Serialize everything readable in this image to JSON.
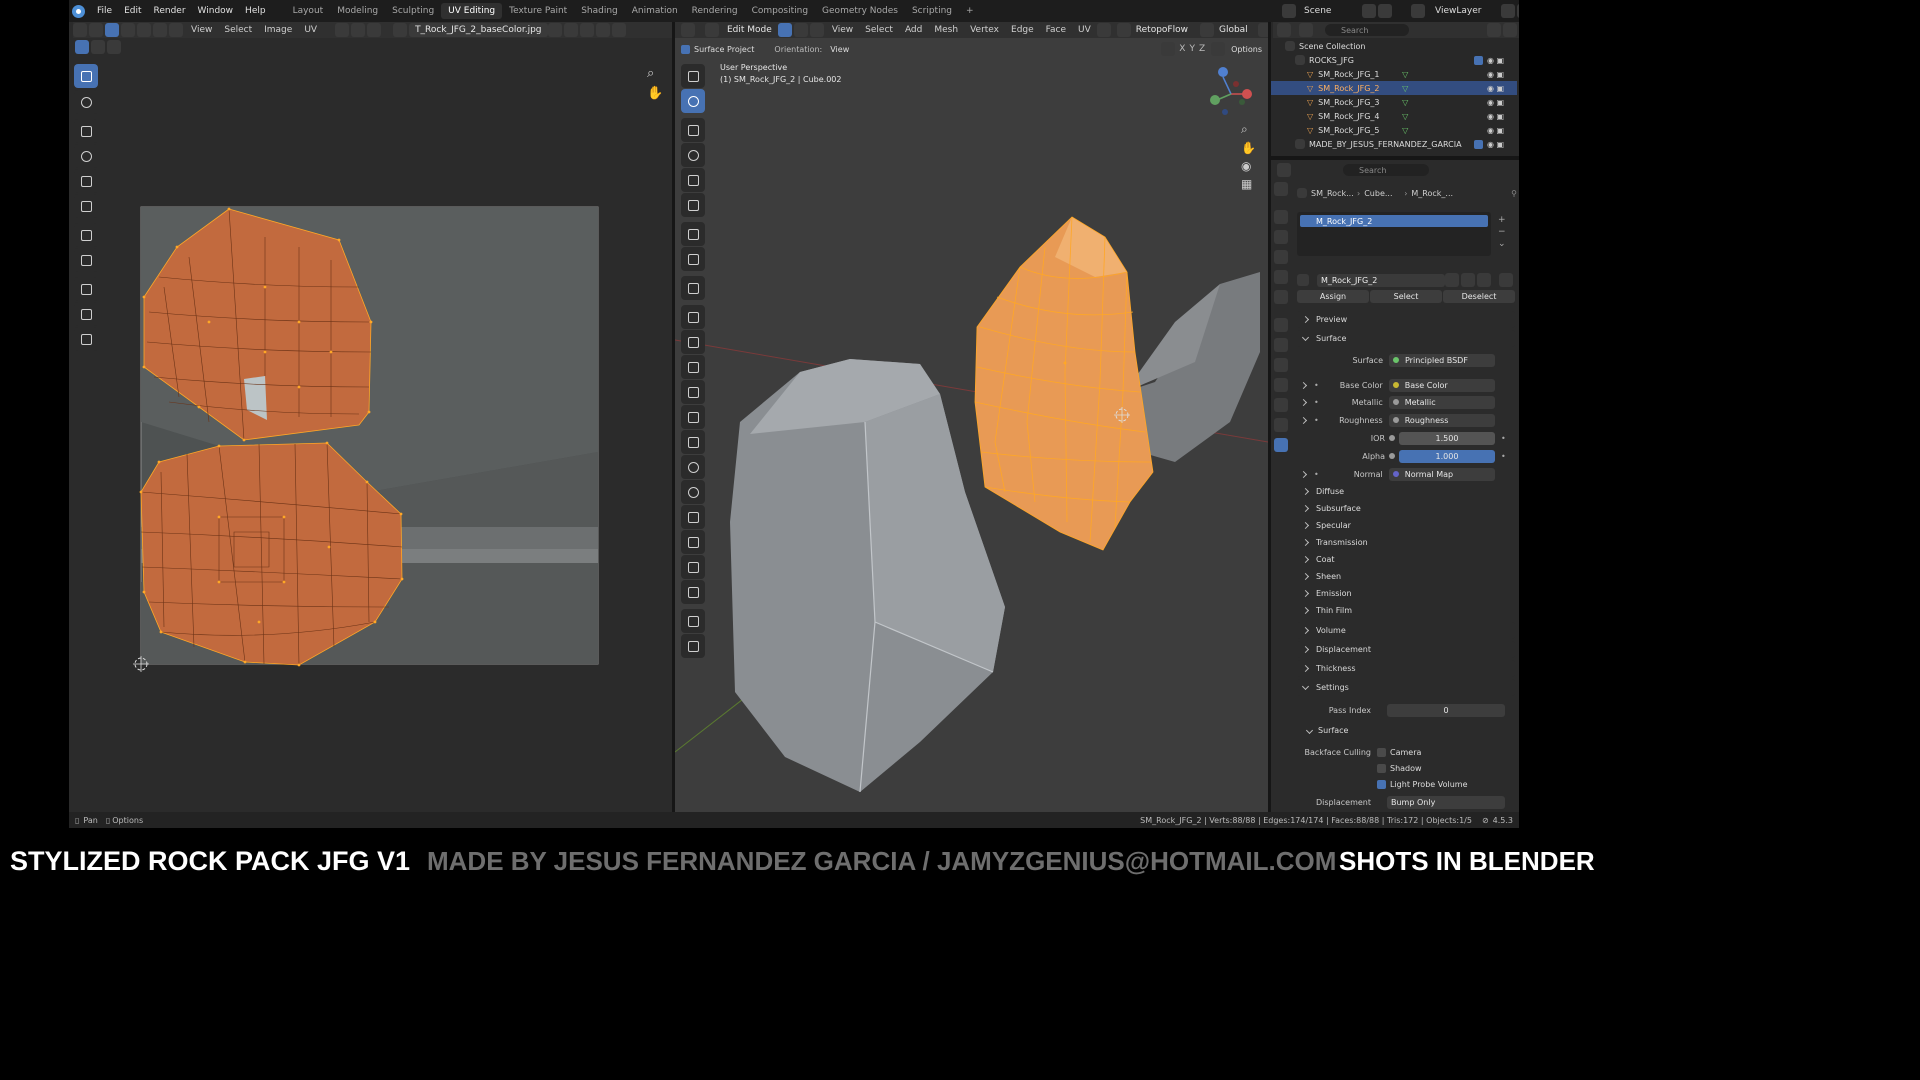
{
  "menu": {
    "file": "File",
    "edit": "Edit",
    "render": "Render",
    "window": "Window",
    "help": "Help"
  },
  "workspaces": [
    "Layout",
    "Modeling",
    "Sculpting",
    "UV Editing",
    "Texture Paint",
    "Shading",
    "Animation",
    "Rendering",
    "Compositing",
    "Geometry Nodes",
    "Scripting"
  ],
  "add_workspace": "+",
  "scene": {
    "label": "Scene",
    "viewlayer": "ViewLayer"
  },
  "uv_editor": {
    "menus": [
      "View",
      "Select",
      "Image",
      "UV"
    ],
    "image_name": "T_Rock_JFG_2_baseColor.jpg"
  },
  "viewport": {
    "mode": "Edit Mode",
    "menus": [
      "View",
      "Select",
      "Add",
      "Mesh",
      "Vertex",
      "Edge",
      "Face",
      "UV"
    ],
    "addon": "RetopoFlow",
    "orientation": "Global",
    "surface_project": "Surface Project",
    "orientation_label": "Orientation:",
    "orientation_value": "View",
    "options": "Options",
    "perspective": "User Perspective",
    "object_info": "(1) SM_Rock_JFG_2 | Cube.002",
    "gizmo": {
      "x": "X",
      "y": "Y",
      "z": "Z"
    }
  },
  "outliner": {
    "search_placeholder": "Search",
    "title": "Scene Collection",
    "collection": "ROCKS_JFG",
    "items": [
      "SM_Rock_JFG_1",
      "SM_Rock_JFG_2",
      "SM_Rock_JFG_3",
      "SM_Rock_JFG_4",
      "SM_Rock_JFG_5"
    ],
    "selected_index": 1,
    "made_by": "MADE_BY_JESUS_FERNANDEZ_GARCIA"
  },
  "properties": {
    "search_placeholder": "Search",
    "breadcrumb": [
      "SM_Rock...",
      "Cube...",
      "M_Rock_..."
    ],
    "slot": "M_Rock_JFG_2",
    "material": "M_Rock_JFG_2",
    "buttons": {
      "assign": "Assign",
      "select": "Select",
      "deselect": "Deselect"
    },
    "preview": "Preview",
    "surface_header": "Surface",
    "surface_row": {
      "label": "Surface",
      "value": "Principled BSDF"
    },
    "inputs": [
      {
        "label": "Base Color",
        "value": "Base Color",
        "color": "#c8b832"
      },
      {
        "label": "Metallic",
        "value": "Metallic",
        "color": "#9a9a9a"
      },
      {
        "label": "Roughness",
        "value": "Roughness",
        "color": "#9a9a9a"
      }
    ],
    "ior": {
      "label": "IOR",
      "value": "1.500"
    },
    "alpha": {
      "label": "Alpha",
      "value": "1.000"
    },
    "normal": {
      "label": "Normal",
      "value": "Normal Map",
      "color": "#6464c8"
    },
    "subpanels": [
      "Diffuse",
      "Subsurface",
      "Specular",
      "Transmission",
      "Coat",
      "Sheen",
      "Emission",
      "Thin Film"
    ],
    "volume": "Volume",
    "displacement": "Displacement",
    "thickness": "Thickness",
    "settings": "Settings",
    "pass_index": {
      "label": "Pass Index",
      "value": "0"
    },
    "settings_surface": "Surface",
    "backface_culling": "Backface Culling",
    "camera": "Camera",
    "shadow": "Shadow",
    "light_probe": "Light Probe Volume",
    "displacement_method": {
      "label": "Displacement",
      "value": "Bump Only"
    }
  },
  "statusbar": {
    "pan": "Pan",
    "options": "Options",
    "stats": "SM_Rock_JFG_2 | Verts:88/88 | Edges:174/174 | Faces:88/88 | Tris:172 | Objects:1/5",
    "version": "4.5.3"
  },
  "footer": {
    "left": "STYLIZED ROCK PACK JFG V1",
    "center": "MADE BY JESUS FERNANDEZ GARCIA / JAMYZGENIUS@HOTMAIL.COM",
    "right": "SHOTS IN BLENDER"
  },
  "colors": {
    "accent": "#4772b3",
    "uv_mesh": "#c26a3e",
    "edge_highlight": "#ffa726",
    "selected_mesh": "#e89a55"
  }
}
